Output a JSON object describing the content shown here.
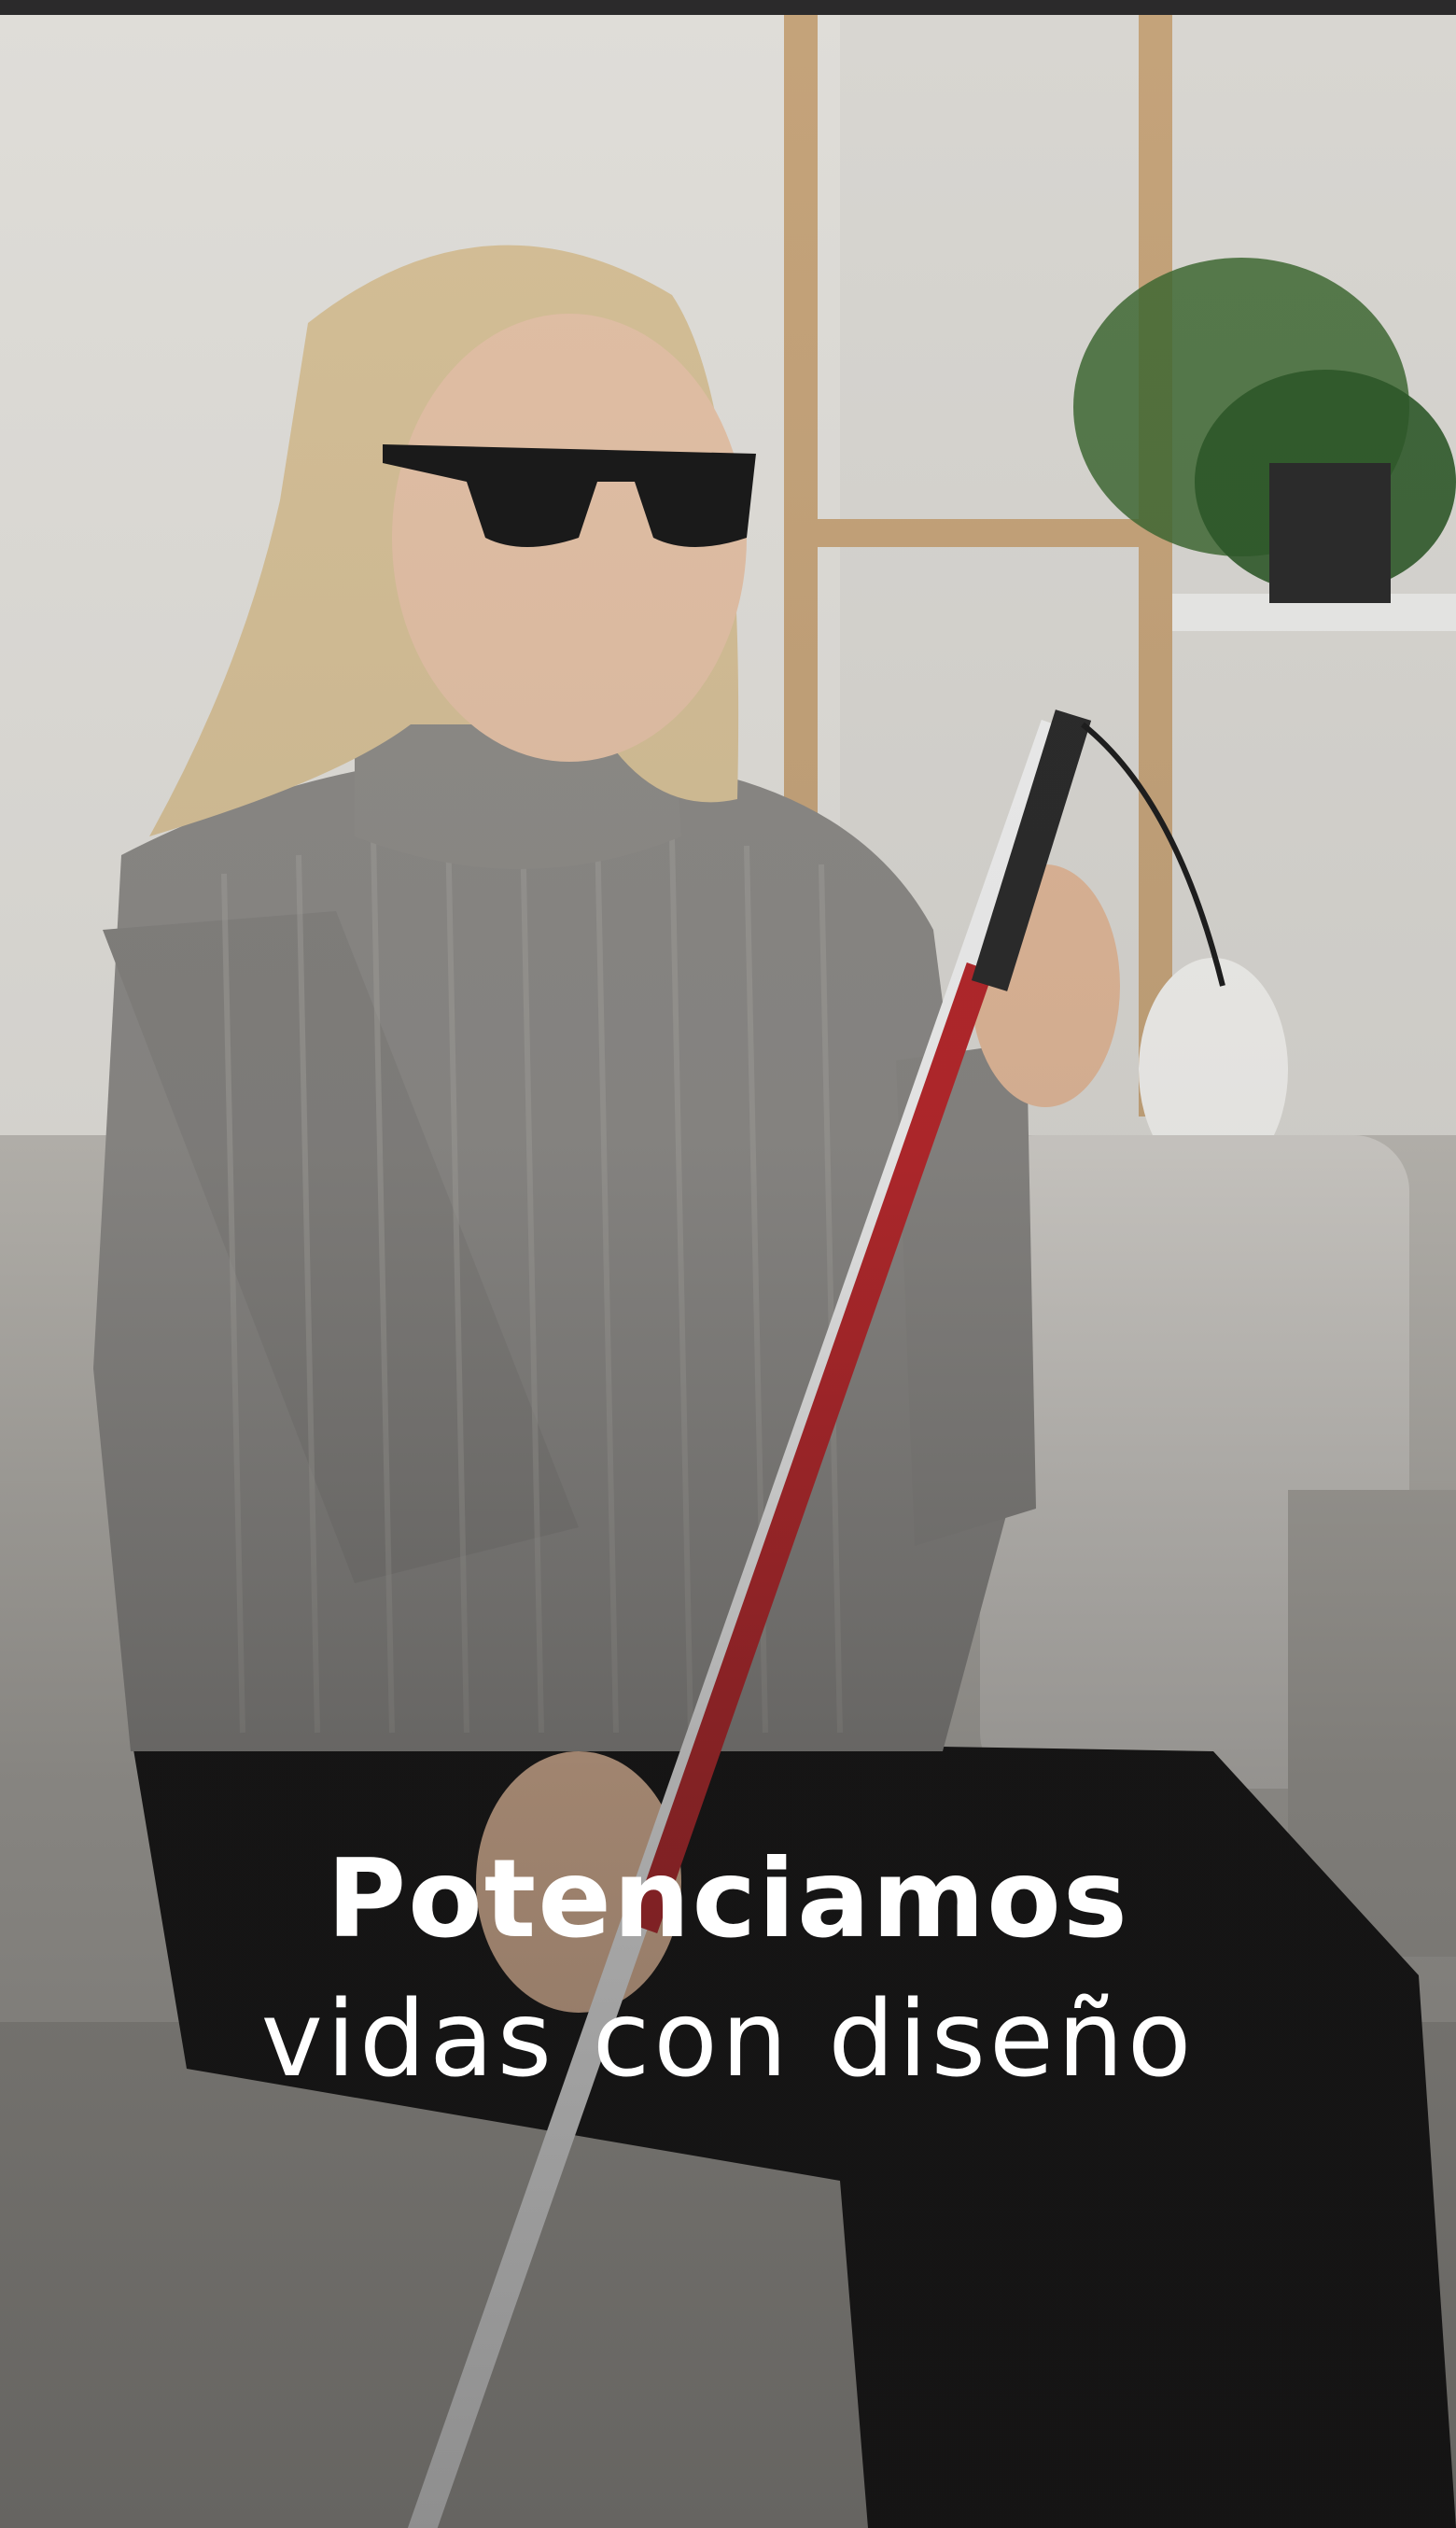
{
  "hero": {
    "headline_strong": "Potenciamos",
    "headline_light": "vidas con diseño",
    "image_description": "photo-woman-with-white-cane"
  },
  "colors": {
    "text": "#ffffff",
    "status_bar": "#2b2a2b"
  }
}
